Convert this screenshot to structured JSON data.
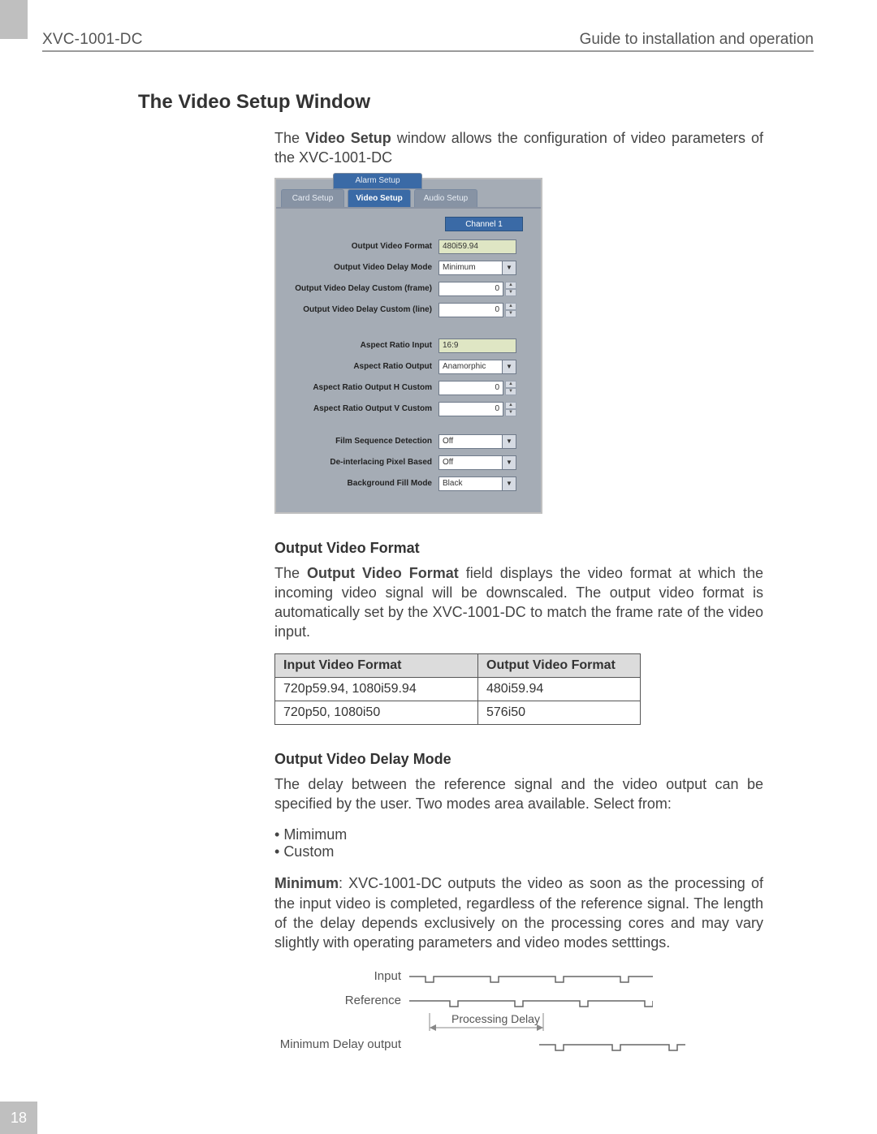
{
  "header": {
    "left": "XVC-1001-DC",
    "right": "Guide to installation and operation"
  },
  "page_number": "18",
  "h1": "The Video Setup Window",
  "intro": {
    "pre": "The ",
    "bold": "Video Setup",
    "post": " window allows the configuration of video parameters of the XVC-1001-DC"
  },
  "fig": {
    "tab_back": "Alarm Setup",
    "tabs": [
      "Card Setup",
      "Video Setup",
      "Audio Setup"
    ],
    "channel_header": "Channel 1",
    "rows": [
      {
        "label": "Output Video Format",
        "type": "readonly",
        "value": "480i59.94"
      },
      {
        "label": "Output Video Delay Mode",
        "type": "dropdown",
        "value": "Minimum"
      },
      {
        "label": "Output Video Delay Custom (frame)",
        "type": "spinner",
        "value": "0"
      },
      {
        "label": "Output Video Delay Custom (line)",
        "type": "spinner",
        "value": "0"
      }
    ],
    "rows2": [
      {
        "label": "Aspect Ratio Input",
        "type": "readonly",
        "value": "16:9"
      },
      {
        "label": "Aspect Ratio Output",
        "type": "dropdown",
        "value": "Anamorphic"
      },
      {
        "label": "Aspect Ratio Output H Custom",
        "type": "spinner",
        "value": "0"
      },
      {
        "label": "Aspect Ratio Output V Custom",
        "type": "spinner",
        "value": "0"
      }
    ],
    "rows3": [
      {
        "label": "Film Sequence Detection",
        "type": "dropdown",
        "value": "Off"
      },
      {
        "label": "De-interlacing Pixel Based",
        "type": "dropdown",
        "value": "Off"
      },
      {
        "label": "Background Fill Mode",
        "type": "dropdown",
        "value": "Black"
      }
    ]
  },
  "sec_ovf": {
    "title": "Output Video Format",
    "para": {
      "pre": "The ",
      "bold": "Output Video Format",
      "post": " field displays the video format at which the incoming video signal will be downscaled. The output video format is automatically set by the XVC-1001-DC to match the frame rate of the video input."
    }
  },
  "fmt_table": {
    "headers": [
      "Input Video Format",
      "Output Video Format"
    ],
    "rows": [
      [
        "720p59.94, 1080i59.94",
        "480i59.94"
      ],
      [
        "720p50, 1080i50",
        "576i50"
      ]
    ]
  },
  "sec_ovdm": {
    "title": "Output Video Delay Mode",
    "para1": "The delay between the reference signal and the video output can be specified by the user. Two modes area available. Select from:",
    "bullets": [
      "Mimimum",
      "Custom"
    ],
    "para2": {
      "bold": "Minimum",
      "post": ": XVC-1001-DC outputs the video as soon as the processing of the input video is completed, regardless of the reference signal. The length of the delay depends exclusively on the processing cores and may vary slightly with operating parameters and video modes setttings."
    }
  },
  "timing": {
    "input": "Input",
    "reference": "Reference",
    "processing_delay": "Processing Delay",
    "min_output": "Minimum Delay output"
  }
}
